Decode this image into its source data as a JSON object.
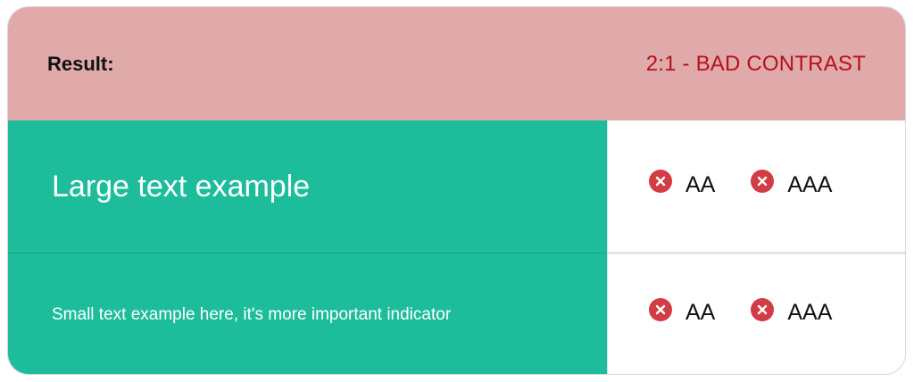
{
  "header": {
    "label": "Result:",
    "value": "2:1 - BAD CONTRAST"
  },
  "rows": [
    {
      "sample_text": "Large text example",
      "checks": [
        {
          "label": "AA",
          "status": "fail",
          "icon": "x-circle-icon"
        },
        {
          "label": "AAA",
          "status": "fail",
          "icon": "x-circle-icon"
        }
      ]
    },
    {
      "sample_text": "Small text example here, it's more important indicator",
      "checks": [
        {
          "label": "AA",
          "status": "fail",
          "icon": "x-circle-icon"
        },
        {
          "label": "AAA",
          "status": "fail",
          "icon": "x-circle-icon"
        }
      ]
    }
  ],
  "colors": {
    "header_bg": "#e0aaaa",
    "result_text": "#b5111b",
    "sample_bg": "#1dbd9b",
    "sample_text": "#ffffff",
    "fail_icon": "#d23c44"
  }
}
